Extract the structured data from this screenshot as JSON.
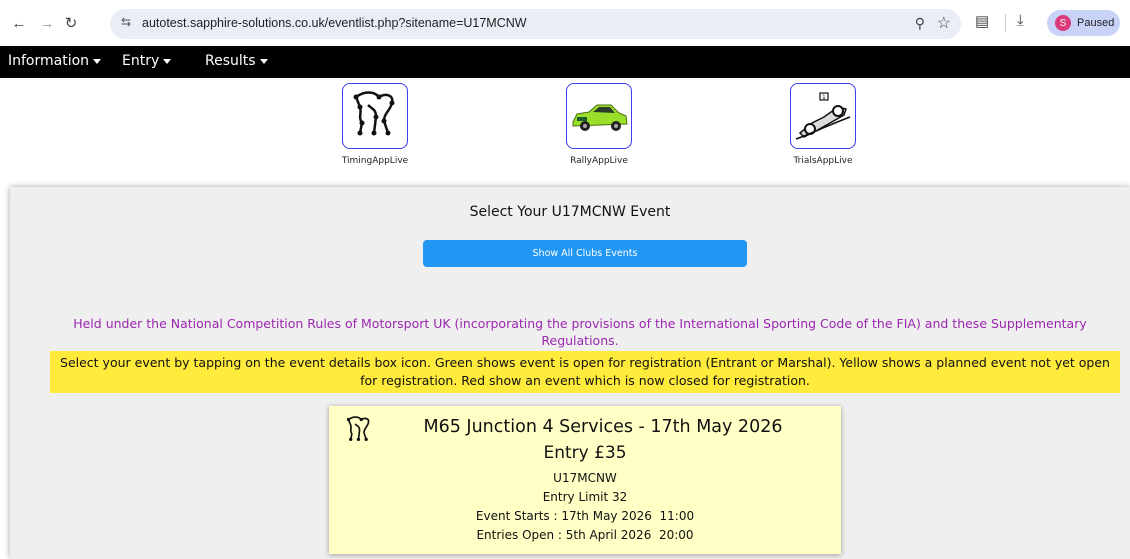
{
  "browser": {
    "url": "autotest.sapphire-solutions.co.uk/eventlist.php?sitename=U17MCNW",
    "profile_initial": "S",
    "profile_status": "Paused"
  },
  "menu": {
    "items": [
      "Information",
      "Entry",
      "Results"
    ]
  },
  "apps": [
    {
      "label": "TimingAppLive",
      "icon": "timing-course-icon"
    },
    {
      "label": "RallyAppLive",
      "icon": "rally-car-icon"
    },
    {
      "label": "TrialsAppLive",
      "icon": "trials-car-icon"
    }
  ],
  "main": {
    "title": "Select Your U17MCNW Event",
    "show_all_label": "Show All Clubs Events",
    "regulations_text": "Held under the National Competition Rules of Motorsport UK (incorporating the provisions of the International Sporting Code of the FIA) and these Supplementary Regulations.",
    "notice_text": "Select your event by tapping on the event details box icon. Green shows event is open for registration (Entrant or Marshal). Yellow shows a planned event not yet open for registration. Red show an event which is now closed for registration."
  },
  "events": [
    {
      "name": "M65 Junction 4 Services - 17th May 2026",
      "entry_fee": "Entry £35",
      "club": "U17MCNW",
      "entry_limit": "Entry Limit 32",
      "starts": "Event Starts : 17th May 2026  11:00",
      "entries_open": "Entries Open : 5th April 2026  20:00",
      "status_color": "#ffffc6"
    }
  ],
  "colors": {
    "accent": "#2196f3",
    "regulations": "#9c27b0",
    "notice_bg": "#ffeb3b",
    "menubar": "#000000"
  }
}
